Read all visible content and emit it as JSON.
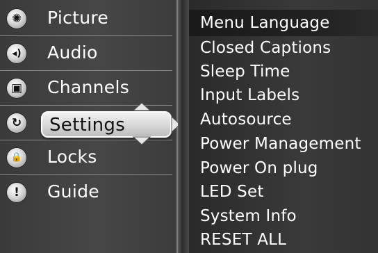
{
  "main_menu": {
    "items": [
      {
        "label": "Picture",
        "icon": "picture-icon",
        "glyph": "✺"
      },
      {
        "label": "Audio",
        "icon": "audio-icon",
        "glyph": "◂)"
      },
      {
        "label": "Channels",
        "icon": "channels-icon",
        "glyph": "▣"
      },
      {
        "label": "Settings",
        "icon": "settings-icon",
        "glyph": "↻"
      },
      {
        "label": "Locks",
        "icon": "lock-icon",
        "glyph": "🔒"
      },
      {
        "label": "Guide",
        "icon": "guide-icon",
        "glyph": "!"
      }
    ],
    "selected": "Settings"
  },
  "settings_submenu": {
    "items": [
      "Menu Language",
      "Closed Captions",
      "Sleep Time",
      "Input Labels",
      "Autosource",
      "Power Management",
      "Power On plug",
      "LED Set",
      "System Info",
      "RESET ALL"
    ],
    "highlighted": "Menu Language"
  },
  "colors": {
    "text": "#ffffff",
    "selected_text": "#111111",
    "panel_bg": "#3c3c3c",
    "divider": "#8a8a8a"
  }
}
